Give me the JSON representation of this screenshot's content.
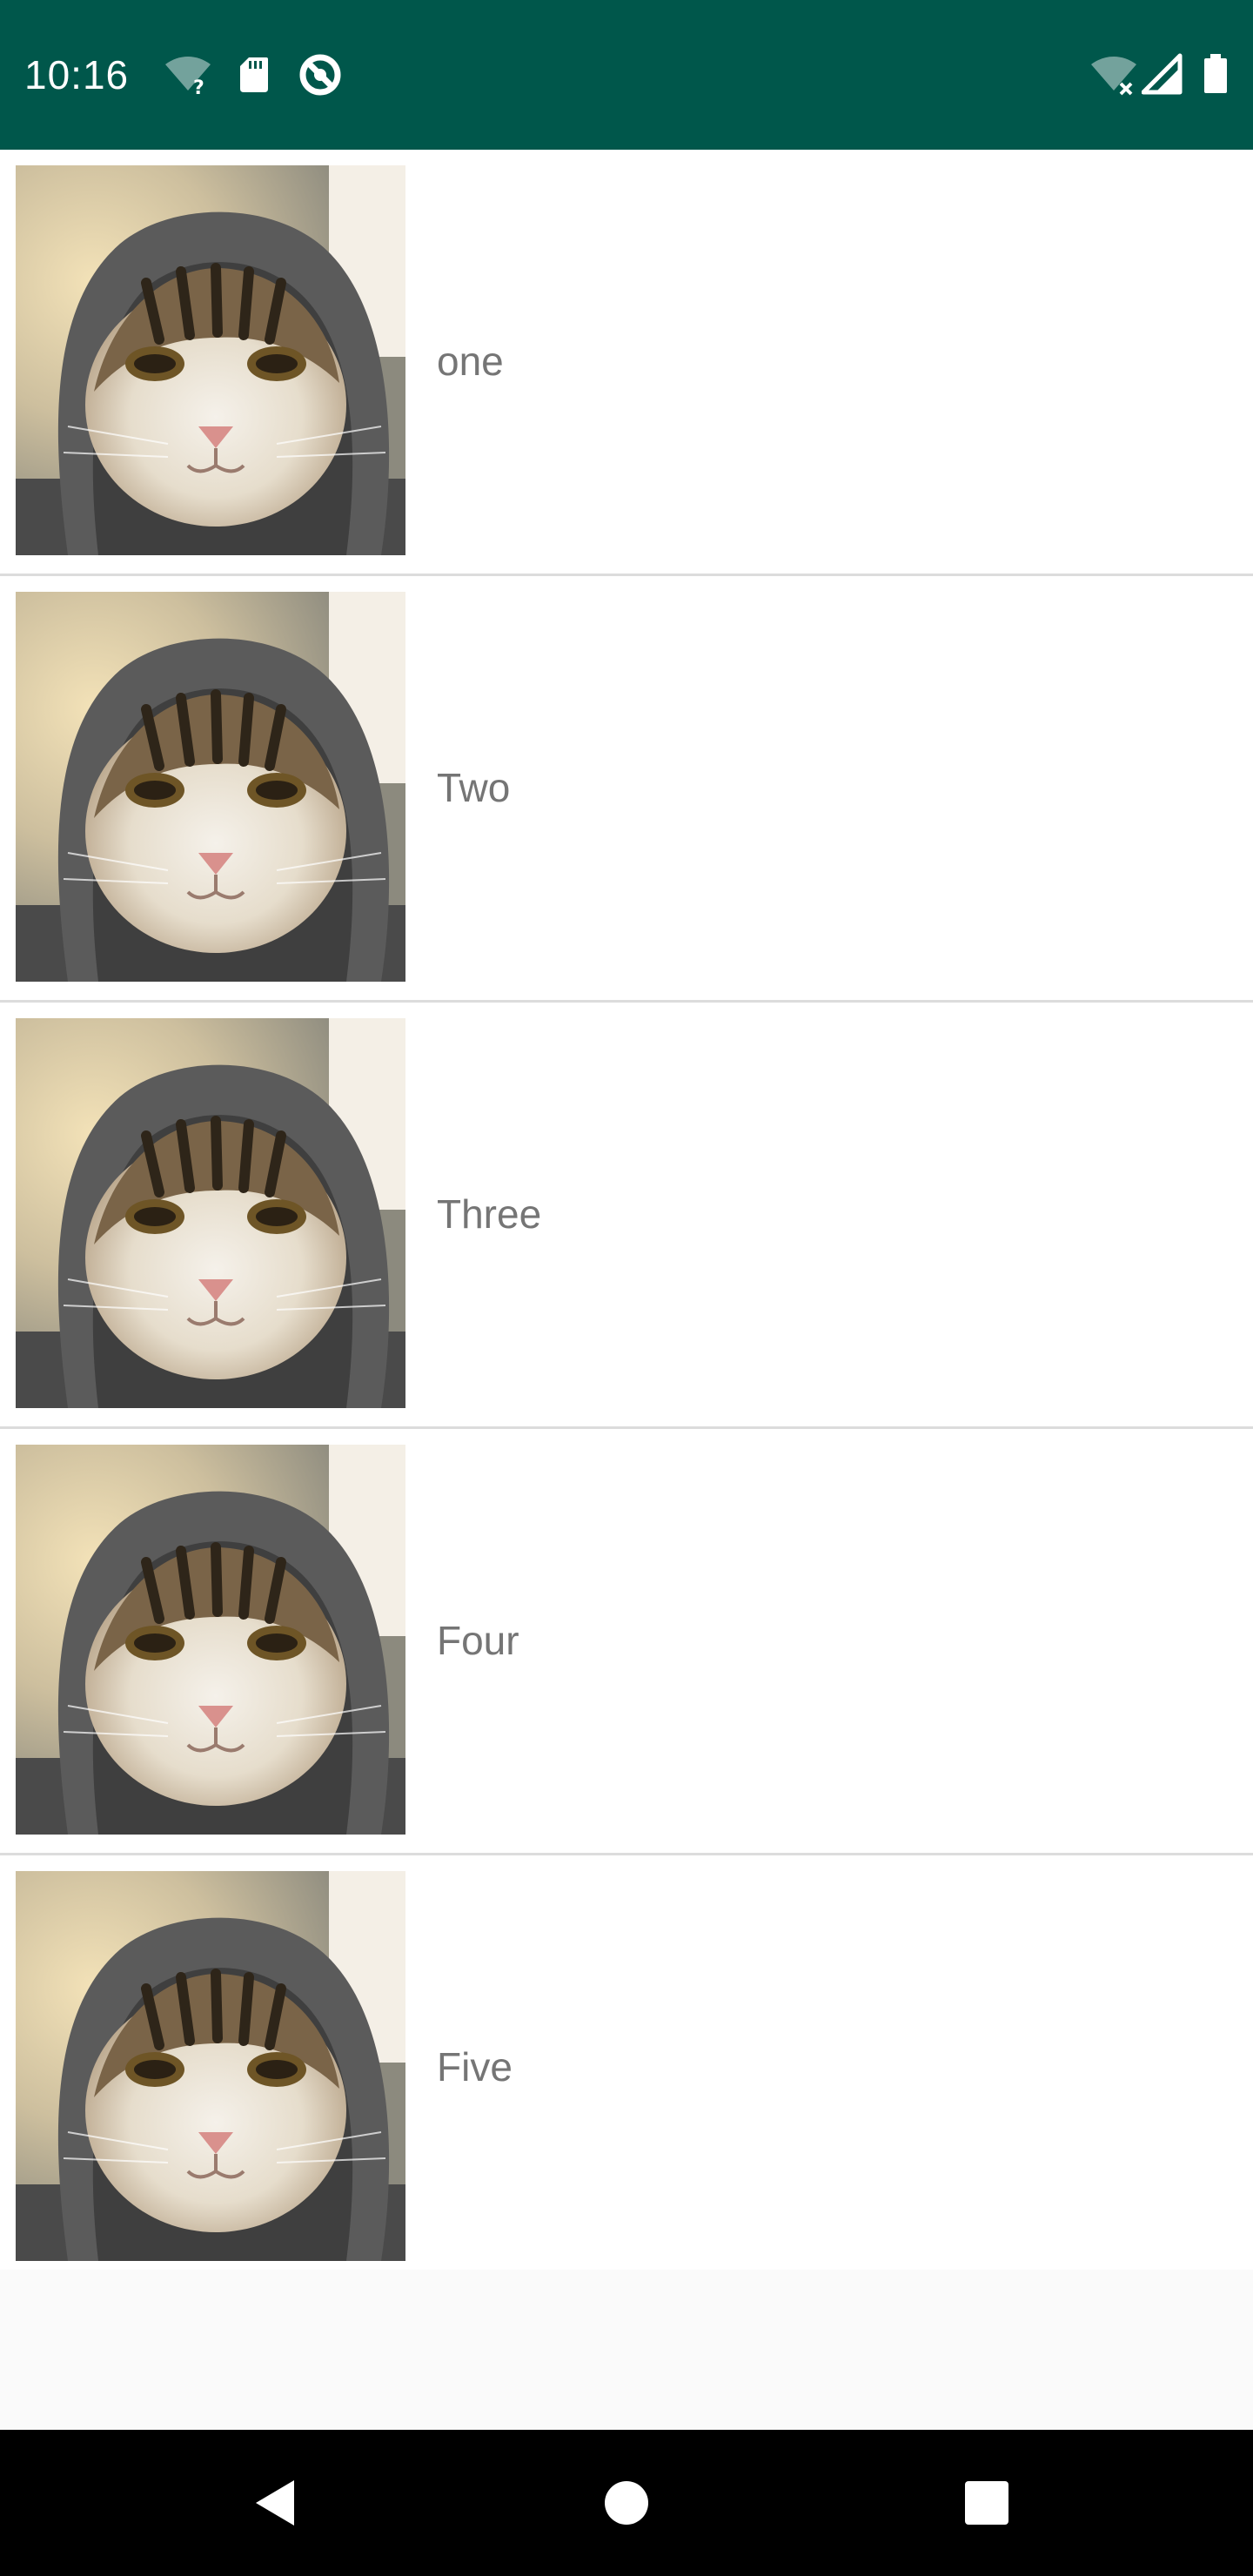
{
  "status_bar": {
    "time": "10:16",
    "background_color": "#00574b",
    "left_icons": [
      "wifi-unknown-icon",
      "sd-card-icon",
      "data-saver-icon"
    ],
    "right_icons": [
      "wifi-off-icon",
      "cell-signal-icon",
      "battery-icon"
    ]
  },
  "list": {
    "items": [
      {
        "label": "one",
        "image": "cat-in-hood-photo"
      },
      {
        "label": "Two",
        "image": "cat-in-hood-photo"
      },
      {
        "label": "Three",
        "image": "cat-in-hood-photo"
      },
      {
        "label": "Four",
        "image": "cat-in-hood-photo"
      },
      {
        "label": "Five",
        "image": "cat-in-hood-photo"
      }
    ]
  },
  "nav_bar": {
    "buttons": [
      "back-icon",
      "home-icon",
      "recents-icon"
    ]
  }
}
